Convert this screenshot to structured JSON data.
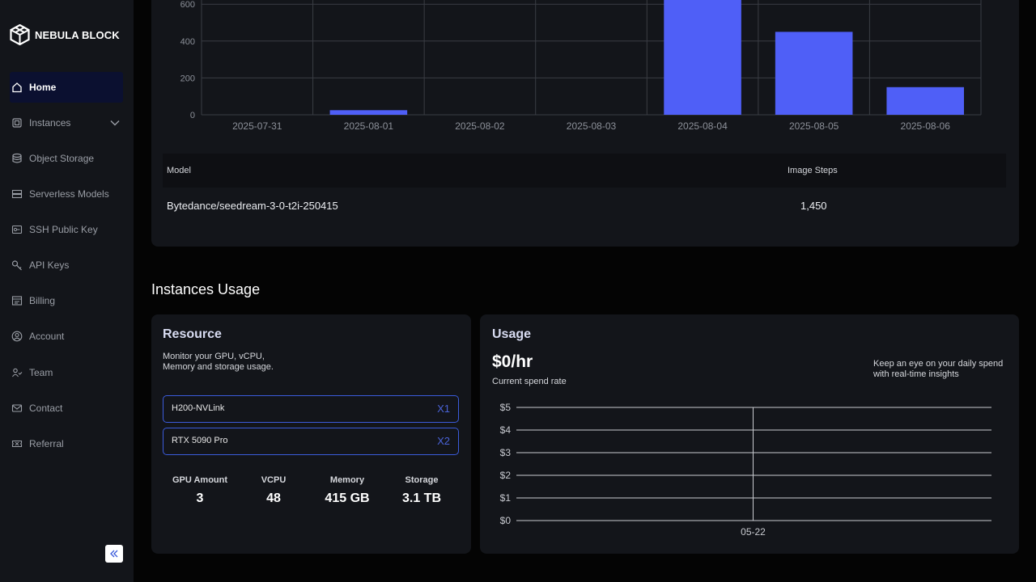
{
  "brand": {
    "name": "NEBULA BLOCK"
  },
  "sidebar": {
    "items": [
      {
        "label": "Home",
        "icon": "home-icon",
        "active": true
      },
      {
        "label": "Instances",
        "icon": "chip-icon",
        "expandable": true
      },
      {
        "label": "Object Storage",
        "icon": "database-icon"
      },
      {
        "label": "Serverless Models",
        "icon": "server-icon"
      },
      {
        "label": "SSH Public Key",
        "icon": "key-card-icon"
      },
      {
        "label": "API Keys",
        "icon": "key-icon"
      },
      {
        "label": "Billing",
        "icon": "billing-icon"
      },
      {
        "label": "Account",
        "icon": "user-circle-icon"
      },
      {
        "label": "Team",
        "icon": "team-icon"
      },
      {
        "label": "Contact",
        "icon": "mail-icon"
      },
      {
        "label": "Referral",
        "icon": "ticket-icon"
      }
    ]
  },
  "chart_data": {
    "type": "bar",
    "categories": [
      "2025-07-31",
      "2025-08-01",
      "2025-08-02",
      "2025-08-03",
      "2025-08-04",
      "2025-08-05",
      "2025-08-06"
    ],
    "values": [
      0,
      25,
      0,
      0,
      630,
      450,
      150
    ],
    "yticks": [
      "0",
      "200",
      "400",
      "600"
    ],
    "ylim": [
      0,
      650
    ],
    "bar_color": "#4f5ff7",
    "grid": true
  },
  "model_table": {
    "headers": {
      "model": "Model",
      "steps": "Image Steps"
    },
    "rows": [
      {
        "model": "Bytedance/seedream-3-0-t2i-250415",
        "steps": "1,450"
      }
    ]
  },
  "instances_usage": {
    "title": "Instances Usage",
    "resource": {
      "title": "Resource",
      "description": "Monitor your GPU, vCPU,\nMemory and storage usage.",
      "gpus": [
        {
          "name": "H200-NVLink",
          "qty": "X1"
        },
        {
          "name": "RTX 5090 Pro",
          "qty": "X2"
        }
      ],
      "stats": [
        {
          "label": "GPU Amount",
          "value": "3"
        },
        {
          "label": "VCPU",
          "value": "48"
        },
        {
          "label": "Memory",
          "value": "415 GB"
        },
        {
          "label": "Storage",
          "value": "3.1 TB"
        }
      ]
    },
    "usage": {
      "title": "Usage",
      "rate": "$0/hr",
      "rate_label": "Current spend rate",
      "note": "Keep an eye on your daily spend\nwith real-time insights",
      "chart": {
        "yticks": [
          "$5",
          "$4",
          "$3",
          "$2",
          "$1",
          "$0"
        ],
        "xticks": [
          "05-22"
        ]
      }
    }
  }
}
